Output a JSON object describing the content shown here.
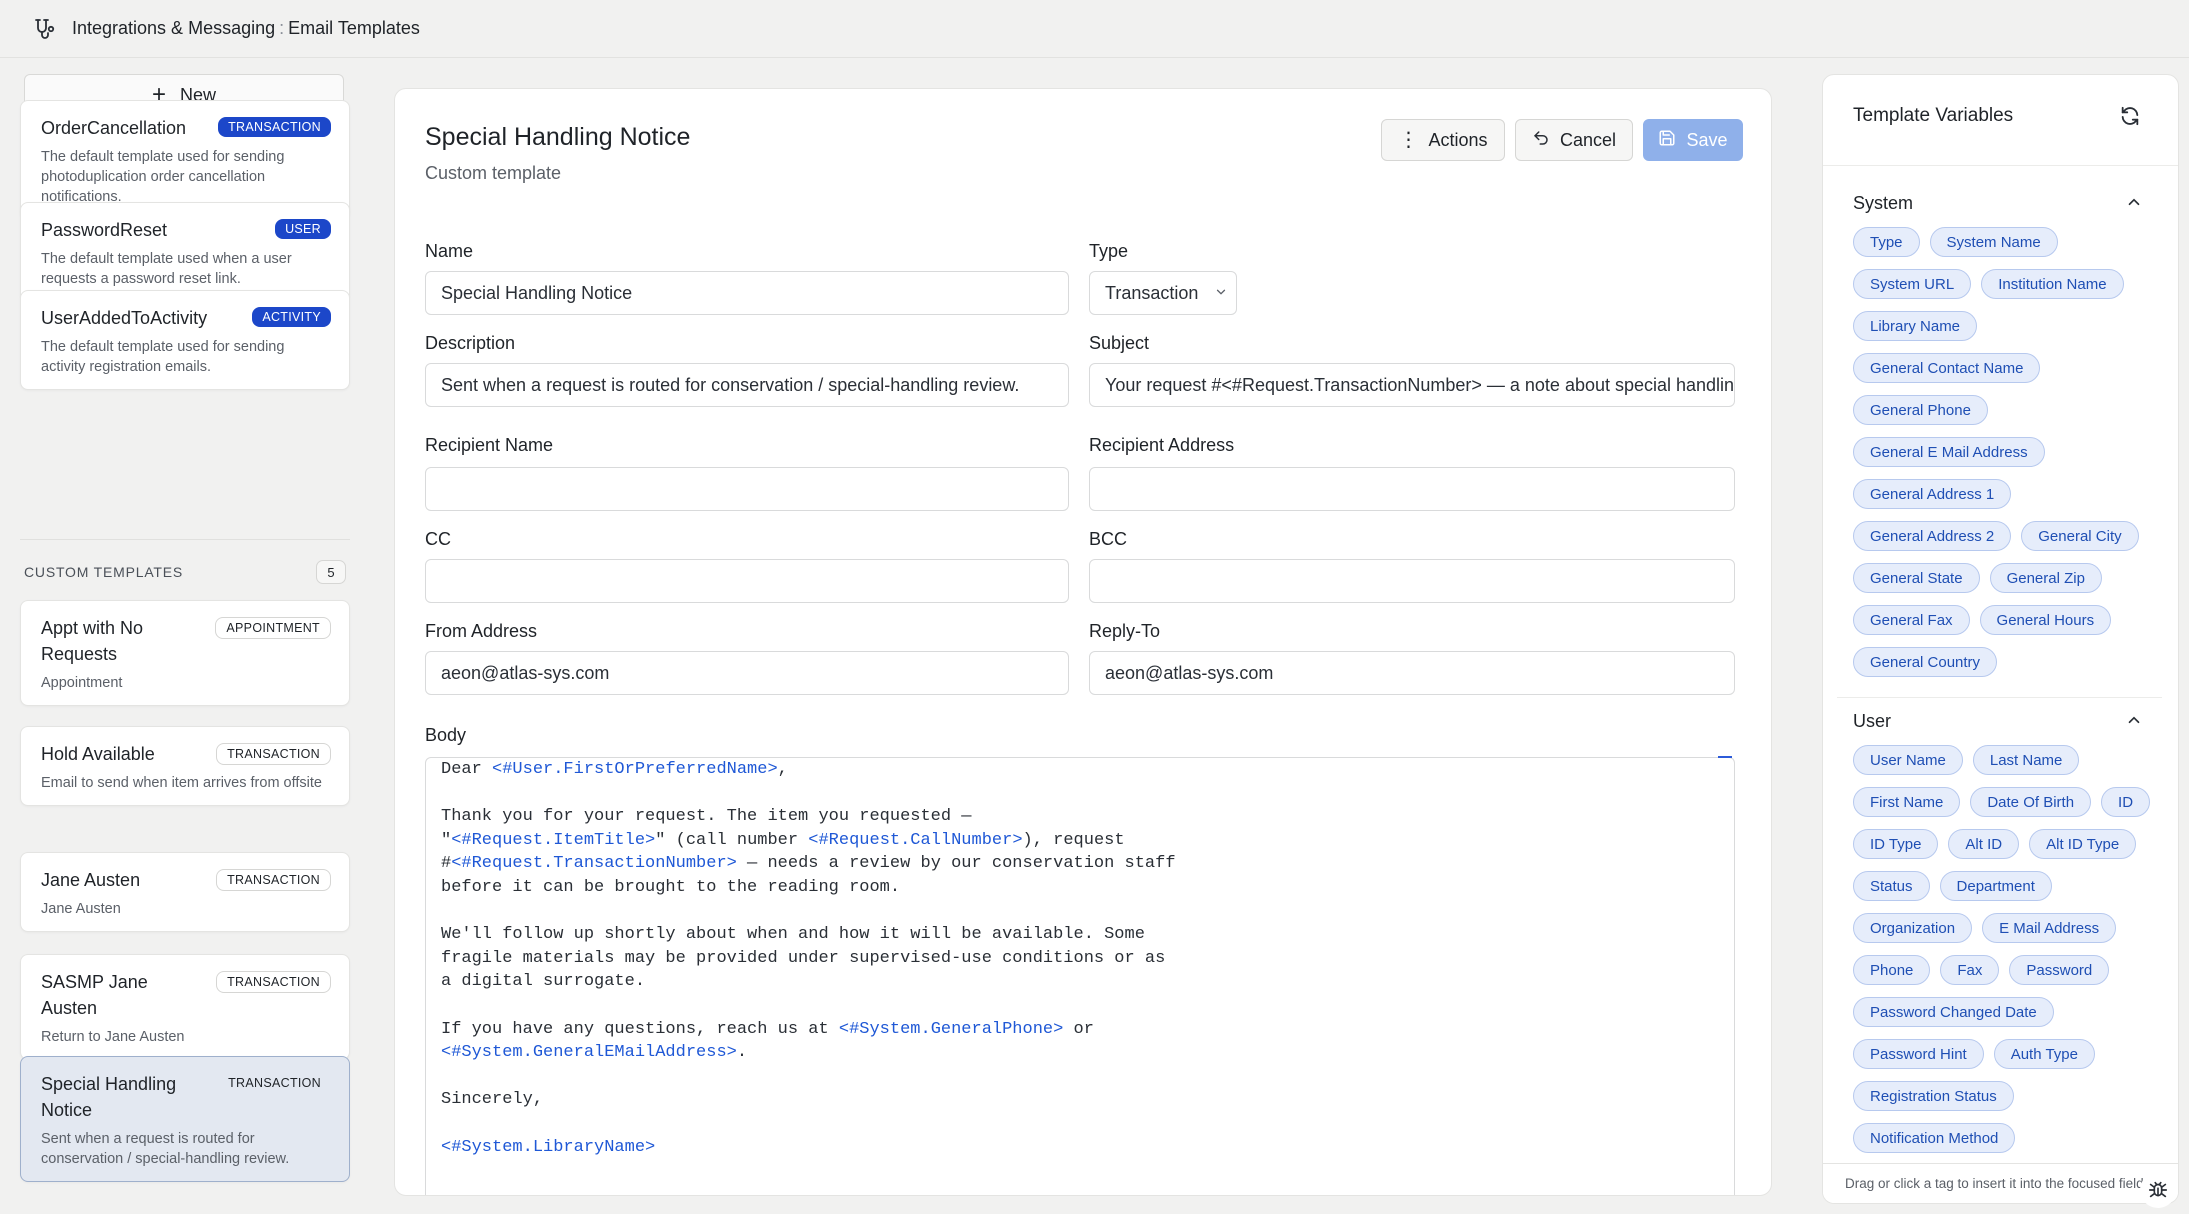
{
  "breadcrumb": {
    "section": "Integrations & Messaging",
    "separator": ":",
    "page": "Email Templates"
  },
  "sidebar": {
    "new_label": "New",
    "default_templates": [
      {
        "name": "OrderCancellation",
        "badge": "TRANSACTION",
        "description": "The default template used for sending photoduplication order cancellation notifications."
      },
      {
        "name": "PasswordReset",
        "badge": "USER",
        "description": "The default template used when a user requests a password reset link."
      },
      {
        "name": "UserAddedToActivity",
        "badge": "ACTIVITY",
        "description": "The default template used for sending activity registration emails."
      }
    ],
    "custom_label": "CUSTOM TEMPLATES",
    "custom_count": "5",
    "custom_templates": [
      {
        "name": "Appt with No Requests",
        "badge": "APPOINTMENT",
        "description": "Appointment"
      },
      {
        "name": "Hold Available",
        "badge": "TRANSACTION",
        "description": "Email to send when item arrives from offsite"
      },
      {
        "name": "Jane Austen",
        "badge": "TRANSACTION",
        "description": "Jane Austen"
      },
      {
        "name": "SASMP Jane Austen",
        "badge": "TRANSACTION",
        "description": "Return to Jane Austen"
      },
      {
        "name": "Special Handling Notice",
        "badge": "TRANSACTION",
        "description": "Sent when a request is routed for conservation / special-handling review."
      }
    ]
  },
  "editor": {
    "title": "Special Handling Notice",
    "subtitle": "Custom template",
    "actions_label": "Actions",
    "cancel_label": "Cancel",
    "save_label": "Save",
    "labels": {
      "name": "Name",
      "type": "Type",
      "description": "Description",
      "subject": "Subject",
      "recipient_name": "Recipient Name",
      "recipient_address": "Recipient Address",
      "cc": "CC",
      "bcc": "BCC",
      "from_address": "From Address",
      "reply_to": "Reply-To",
      "body": "Body"
    },
    "values": {
      "name": "Special Handling Notice",
      "type": "Transaction",
      "description": "Sent when a request is routed for conservation / special-handling review.",
      "subject": "Your request #<#Request.TransactionNumber> — a note about special handling",
      "recipient_name": "",
      "recipient_address": "",
      "cc": "",
      "bcc": "",
      "from_address": "aeon@atlas-sys.com",
      "reply_to": "aeon@atlas-sys.com"
    },
    "body_lines": [
      [
        {
          "t": "Dear "
        },
        {
          "t": "<#User.FirstOrPreferredName>",
          "v": true
        },
        {
          "t": ","
        }
      ],
      [],
      [
        {
          "t": "Thank you for your request. The item you requested —"
        }
      ],
      [
        {
          "t": "\""
        },
        {
          "t": "<#Request.ItemTitle>",
          "v": true
        },
        {
          "t": "\" (call number "
        },
        {
          "t": "<#Request.CallNumber>",
          "v": true
        },
        {
          "t": "), request"
        }
      ],
      [
        {
          "t": "#"
        },
        {
          "t": "<#Request.TransactionNumber>",
          "v": true
        },
        {
          "t": " — needs a review by our conservation staff"
        }
      ],
      [
        {
          "t": "before it can be brought to the reading room."
        }
      ],
      [],
      [
        {
          "t": "We'll follow up shortly about when and how it will be available. Some"
        }
      ],
      [
        {
          "t": "fragile materials may be provided under supervised-use conditions or as"
        }
      ],
      [
        {
          "t": "a digital surrogate."
        }
      ],
      [],
      [
        {
          "t": "If you have any questions, reach us at "
        },
        {
          "t": "<#System.GeneralPhone>",
          "v": true
        },
        {
          "t": " or"
        }
      ],
      [
        {
          "t": "<#System.GeneralEMailAddress>",
          "v": true
        },
        {
          "t": "."
        }
      ],
      [],
      [
        {
          "t": "Sincerely,"
        }
      ],
      [],
      [
        {
          "t": "<#System.LibraryName>",
          "v": true
        }
      ]
    ]
  },
  "variables": {
    "title": "Template Variables",
    "groups": [
      {
        "name": "System",
        "chips": [
          "Type",
          "System Name",
          "System URL",
          "Institution Name",
          "Library Name",
          "General Contact Name",
          "General Phone",
          "General E Mail Address",
          "General Address 1",
          "General Address 2",
          "General City",
          "General State",
          "General Zip",
          "General Fax",
          "General Hours",
          "General Country"
        ]
      },
      {
        "name": "User",
        "chips": [
          "User Name",
          "Last Name",
          "First Name",
          "Date Of Birth",
          "ID",
          "ID Type",
          "Alt ID",
          "Alt ID Type",
          "Status",
          "Department",
          "Organization",
          "E Mail Address",
          "Phone",
          "Fax",
          "Password",
          "Password Changed Date",
          "Password Hint",
          "Auth Type",
          "Registration Status",
          "Notification Method"
        ]
      }
    ],
    "footer": "Drag or click a tag to insert it into the focused field"
  },
  "colors": {
    "accent": "#1c47c9",
    "chip_bg": "#e6edfb",
    "chip_text": "#1f4fb4",
    "save_disabled": "#8fb0ea",
    "token": "#1f58d6"
  }
}
